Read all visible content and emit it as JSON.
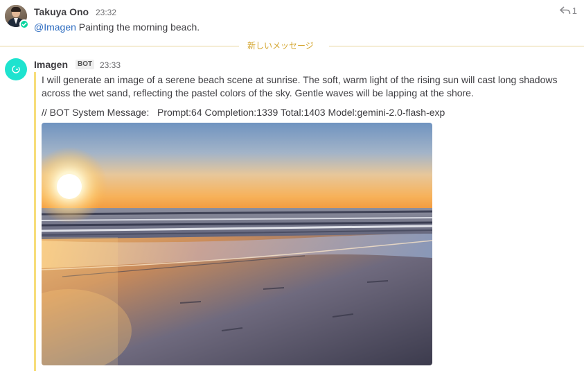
{
  "post1": {
    "username": "Takuya Ono",
    "time": "23:32",
    "mention": "@Imagen",
    "text": " Painting the morning beach.",
    "reply_count": "1"
  },
  "divider": {
    "label": "新しいメッセージ"
  },
  "post2": {
    "username": "Imagen",
    "bot_tag": "BOT",
    "time": "23:33",
    "text": "I will generate an image of a serene beach scene at sunrise. The soft, warm light of the rising sun will cast long shadows across the wet sand, reflecting the pastel colors of the sky. Gentle waves will be lapping at the shore.",
    "system_message": "// BOT System Message:   Prompt:64 Completion:1339 Total:1403 Model:gemini-2.0-flash-exp"
  },
  "colors": {
    "mention": "#2d6cc0",
    "new_messages": "#d4a630",
    "bot_bar": "#f7dd7a",
    "bot_avatar": "#1ee3cf",
    "online_badge": "#06d6a0"
  },
  "icons": {
    "reply": "reply-arrow-icon",
    "status": "check-icon",
    "bot_avatar": "imagen-logo-icon"
  }
}
